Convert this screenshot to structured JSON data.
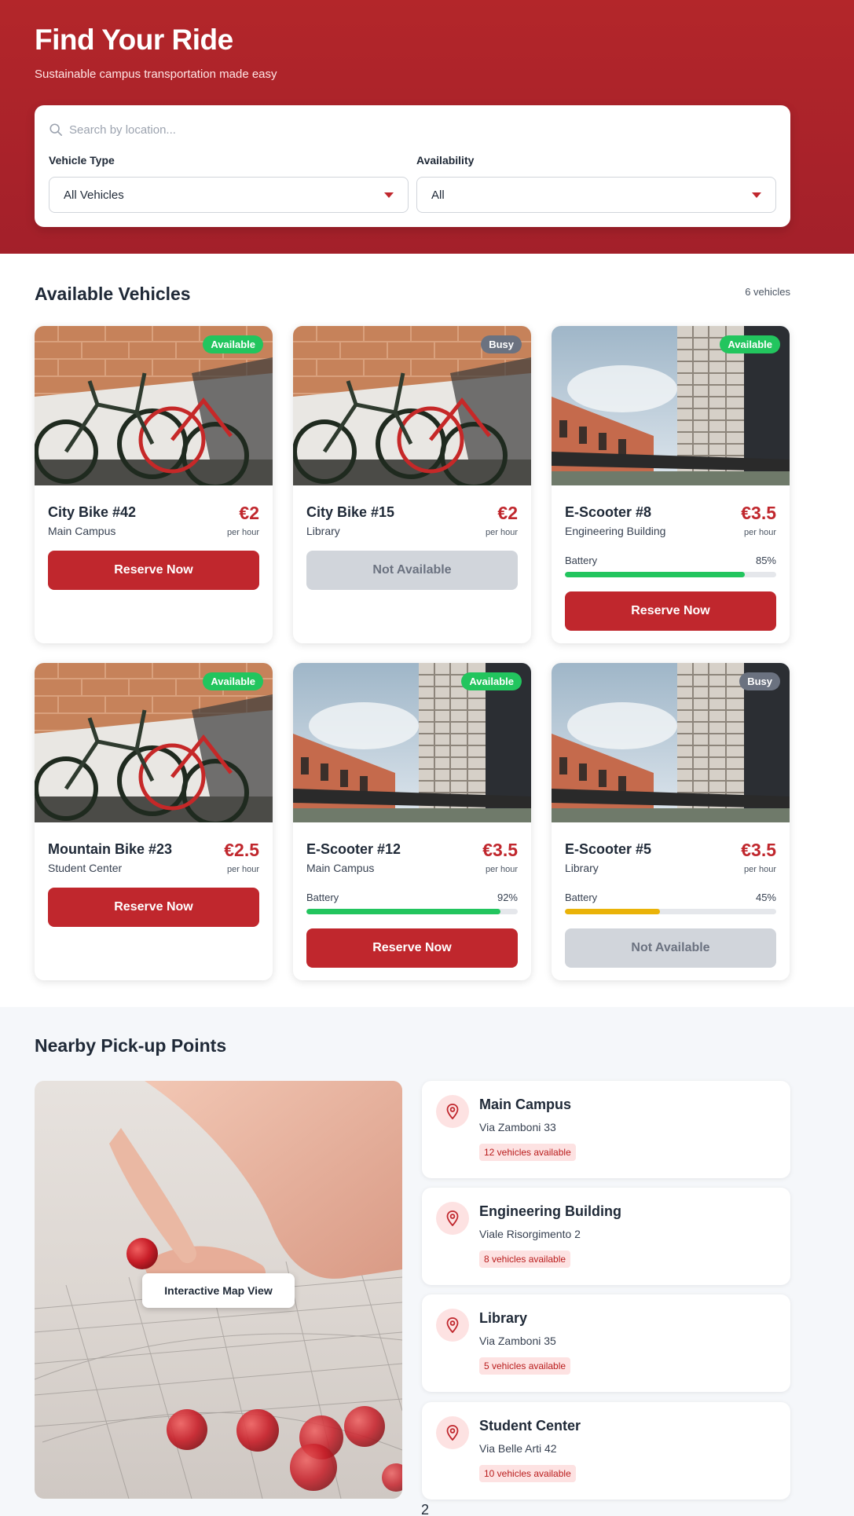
{
  "hero": {
    "title": "Find Your Ride",
    "subtitle": "Sustainable campus transportation made easy",
    "search_placeholder": "Search by location...",
    "vehicle_type_label": "Vehicle Type",
    "vehicle_type_value": "All Vehicles",
    "availability_label": "Availability",
    "availability_value": "All"
  },
  "vehicles_section": {
    "title": "Available Vehicles",
    "count": "6 vehicles"
  },
  "vehicles": [
    {
      "name": "City Bike #42",
      "location": "Main Campus",
      "price": "€2",
      "per": "per hour",
      "status": "Available",
      "button": "Reserve Now",
      "photo": "bikes"
    },
    {
      "name": "City Bike #15",
      "location": "Library",
      "price": "€2",
      "per": "per hour",
      "status": "Busy",
      "button": "Not Available",
      "photo": "bikes"
    },
    {
      "name": "E-Scooter #8",
      "location": "Engineering Building",
      "price": "€3.5",
      "per": "per hour",
      "status": "Available",
      "battery_label": "Battery",
      "battery": "85%",
      "battery_pct": 85,
      "button": "Reserve Now",
      "photo": "building"
    },
    {
      "name": "Mountain Bike #23",
      "location": "Student Center",
      "price": "€2.5",
      "per": "per hour",
      "status": "Available",
      "button": "Reserve Now",
      "photo": "bikes"
    },
    {
      "name": "E-Scooter #12",
      "location": "Main Campus",
      "price": "€3.5",
      "per": "per hour",
      "status": "Available",
      "battery_label": "Battery",
      "battery": "92%",
      "battery_pct": 92,
      "button": "Reserve Now",
      "photo": "building"
    },
    {
      "name": "E-Scooter #5",
      "location": "Library",
      "price": "€3.5",
      "per": "per hour",
      "status": "Busy",
      "battery_label": "Battery",
      "battery": "45%",
      "battery_pct": 45,
      "button": "Not Available",
      "photo": "building"
    }
  ],
  "nearby": {
    "title": "Nearby Pick-up Points",
    "map_label": "Interactive Map View",
    "points": [
      {
        "name": "Main Campus",
        "address": "Via Zamboni 33",
        "available": "12 vehicles available"
      },
      {
        "name": "Engineering Building",
        "address": "Viale Risorgimento 2",
        "available": "8 vehicles available"
      },
      {
        "name": "Library",
        "address": "Via Zamboni 35",
        "available": "5 vehicles available"
      },
      {
        "name": "Student Center",
        "address": "Via Belle Arti 42",
        "available": "10 vehicles available"
      }
    ]
  },
  "page_number": "2",
  "colors": {
    "brand": "#c0272d",
    "available": "#22c55e",
    "busy": "#6b7280",
    "battery_high": "#22c55e",
    "battery_mid": "#eab308"
  },
  "icons": [
    "search-icon",
    "chevron-down-icon",
    "location-pin-icon"
  ]
}
